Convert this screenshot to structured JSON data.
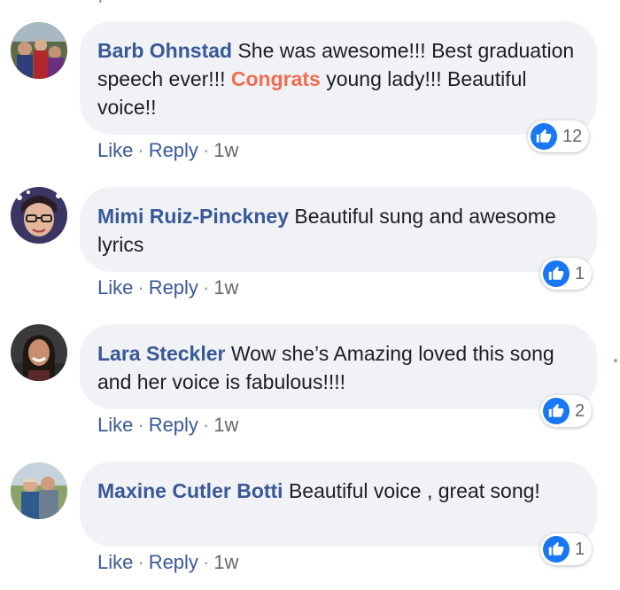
{
  "top_fragment": "·",
  "like_icon_name": "thumbs-up-icon",
  "colors": {
    "author": "#385898",
    "highlight": "#f36c4f",
    "bubble": "#f0f2f5",
    "like_blue": "#1877f2"
  },
  "comments": [
    {
      "author": "Barb Ohnstad",
      "text_before": " She was awesome!!! Best graduation speech ever!!! ",
      "highlight": "Congrats",
      "text_after": " young lady!!! Beautiful voice!!",
      "like_label": "Like",
      "reply_label": "Reply",
      "time": "1w",
      "reactions": "12"
    },
    {
      "author": "Mimi Ruiz-Pinckney",
      "text": " Beautiful sung and awesome lyrics",
      "like_label": "Like",
      "reply_label": "Reply",
      "time": "1w",
      "reactions": "1"
    },
    {
      "author": "Lara Steckler",
      "text": " Wow she’s Amazing loved this song and her voice is fabulous!!!!",
      "like_label": "Like",
      "reply_label": "Reply",
      "time": "1w",
      "reactions": "2"
    },
    {
      "author": "Maxine Cutler Botti",
      "text": " Beautiful voice , great song!",
      "like_label": "Like",
      "reply_label": "Reply",
      "time": "1w",
      "reactions": "1"
    }
  ]
}
